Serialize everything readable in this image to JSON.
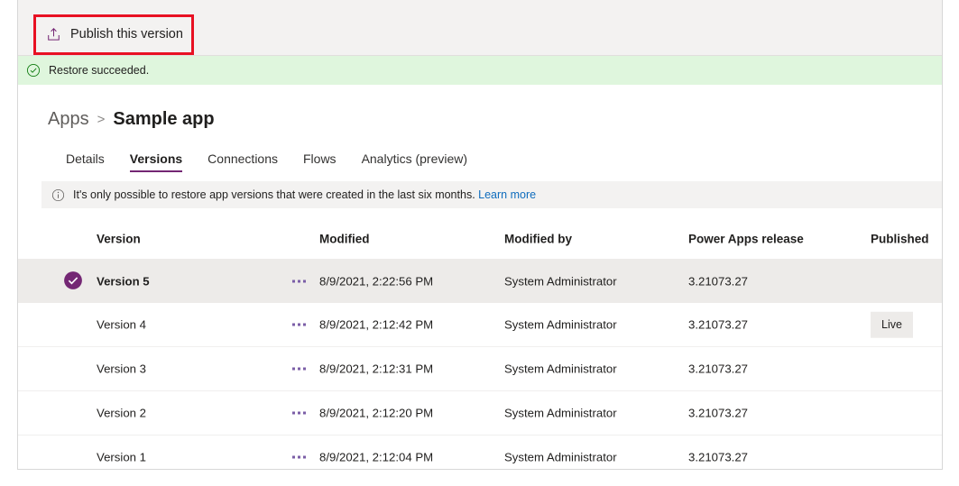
{
  "commandbar": {
    "publish_label": "Publish this version",
    "publish_icon": "publish-upload-icon",
    "accent_color": "#742774",
    "background": "#f3f2f1",
    "annotation_color": "#e81123"
  },
  "message_bar": {
    "text": "Restore succeeded.",
    "icon": "success-check-circle-icon",
    "background": "#dff6dd",
    "icon_color": "#107c10"
  },
  "breadcrumb": {
    "root": "Apps",
    "separator": ">",
    "current": "Sample app"
  },
  "tabs": [
    {
      "label": "Details",
      "active": false
    },
    {
      "label": "Versions",
      "active": true
    },
    {
      "label": "Connections",
      "active": false
    },
    {
      "label": "Flows",
      "active": false
    },
    {
      "label": "Analytics (preview)",
      "active": false
    }
  ],
  "info_bar": {
    "icon": "info-circle-icon",
    "text": "It's only possible to restore app versions that were created in the last six months.",
    "link_label": "Learn more",
    "background": "#f3f2f1",
    "link_color": "#0f6cbd"
  },
  "table": {
    "columns": [
      {
        "key": "version",
        "label": "Version"
      },
      {
        "key": "modified",
        "label": "Modified"
      },
      {
        "key": "modified_by",
        "label": "Modified by"
      },
      {
        "key": "release",
        "label": "Power Apps release"
      },
      {
        "key": "published",
        "label": "Published"
      }
    ],
    "overflow_icon": "more-options-ellipsis-icon",
    "selected_icon": "selected-check-circle-icon",
    "selected_icon_color": "#742774",
    "rows": [
      {
        "selected": true,
        "version": "Version 5",
        "modified": "8/9/2021, 2:22:56 PM",
        "modified_by": "System Administrator",
        "release": "3.21073.27",
        "published": ""
      },
      {
        "selected": false,
        "version": "Version 4",
        "modified": "8/9/2021, 2:12:42 PM",
        "modified_by": "System Administrator",
        "release": "3.21073.27",
        "published": "Live"
      },
      {
        "selected": false,
        "version": "Version 3",
        "modified": "8/9/2021, 2:12:31 PM",
        "modified_by": "System Administrator",
        "release": "3.21073.27",
        "published": ""
      },
      {
        "selected": false,
        "version": "Version 2",
        "modified": "8/9/2021, 2:12:20 PM",
        "modified_by": "System Administrator",
        "release": "3.21073.27",
        "published": ""
      },
      {
        "selected": false,
        "version": "Version 1",
        "modified": "8/9/2021, 2:12:04 PM",
        "modified_by": "System Administrator",
        "release": "3.21073.27",
        "published": ""
      }
    ]
  }
}
